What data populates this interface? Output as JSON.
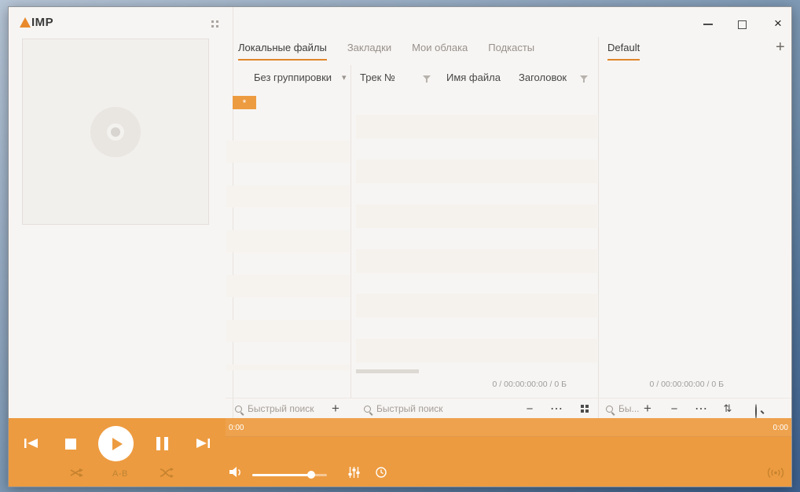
{
  "window": {
    "logo_text": "IMP",
    "controls": {
      "close": "×"
    }
  },
  "tabs": {
    "items": [
      {
        "label": "Локальные файлы",
        "active": true
      },
      {
        "label": "Закладки",
        "active": false
      },
      {
        "label": "Мои облака",
        "active": false
      },
      {
        "label": "Подкасты",
        "active": false
      }
    ],
    "playlist_tab": "Default",
    "add": "+"
  },
  "library": {
    "grouping_label": "Без группировки",
    "grouping_caret": "▾",
    "columns": {
      "track": "Трек №",
      "filename": "Имя файла",
      "title": "Заголовок"
    },
    "group_badge": "*",
    "status": "0 / 00:00:00:00 / 0 Б"
  },
  "playlist": {
    "status": "0 / 00:00:00:00 / 0 Б"
  },
  "search": {
    "left_placeholder": "Быстрый поиск",
    "middle_placeholder": "Быстрый поиск",
    "right_placeholder": "Бы..."
  },
  "player": {
    "elapsed": "0:00",
    "remaining": "0:00",
    "ab_label": "A-B"
  },
  "icons": {
    "plus": "+",
    "minus": "−",
    "ellipsis": "⋯",
    "updown": "⇅"
  },
  "skeleton": {
    "left_bands": 6,
    "middle_bands": 6
  },
  "colors": {
    "accent": "#ed9b40",
    "tab_underline": "#e0862a"
  }
}
